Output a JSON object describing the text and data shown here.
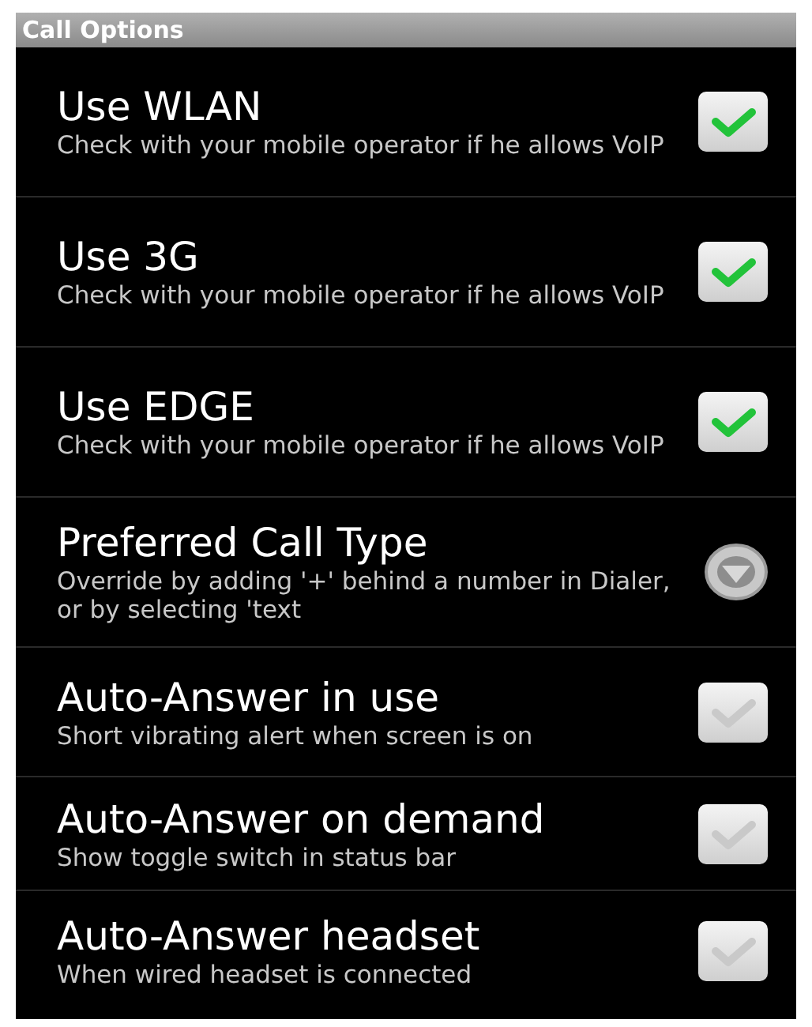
{
  "header": {
    "title": "Call Options"
  },
  "settings": [
    {
      "kind": "checkbox",
      "title": "Use WLAN",
      "summary": "Check with your mobile operator if he allows VoIP",
      "checked": true
    },
    {
      "kind": "checkbox",
      "title": "Use 3G",
      "summary": "Check with your mobile operator if he allows VoIP",
      "checked": true
    },
    {
      "kind": "checkbox",
      "title": "Use EDGE",
      "summary": "Check with your mobile operator if he allows VoIP",
      "checked": true
    },
    {
      "kind": "dropdown",
      "title": "Preferred Call Type",
      "summary": "Override by adding '+' behind a number in Dialer, or by selecting 'text"
    },
    {
      "kind": "checkbox",
      "title": "Auto-Answer in use",
      "summary": "Short vibrating alert when screen is on",
      "checked": false
    },
    {
      "kind": "checkbox",
      "title": "Auto-Answer on demand",
      "summary": "Show toggle switch in status bar",
      "checked": false
    },
    {
      "kind": "checkbox",
      "title": "Auto-Answer headset",
      "summary": "When wired headset is connected",
      "checked": false
    }
  ]
}
